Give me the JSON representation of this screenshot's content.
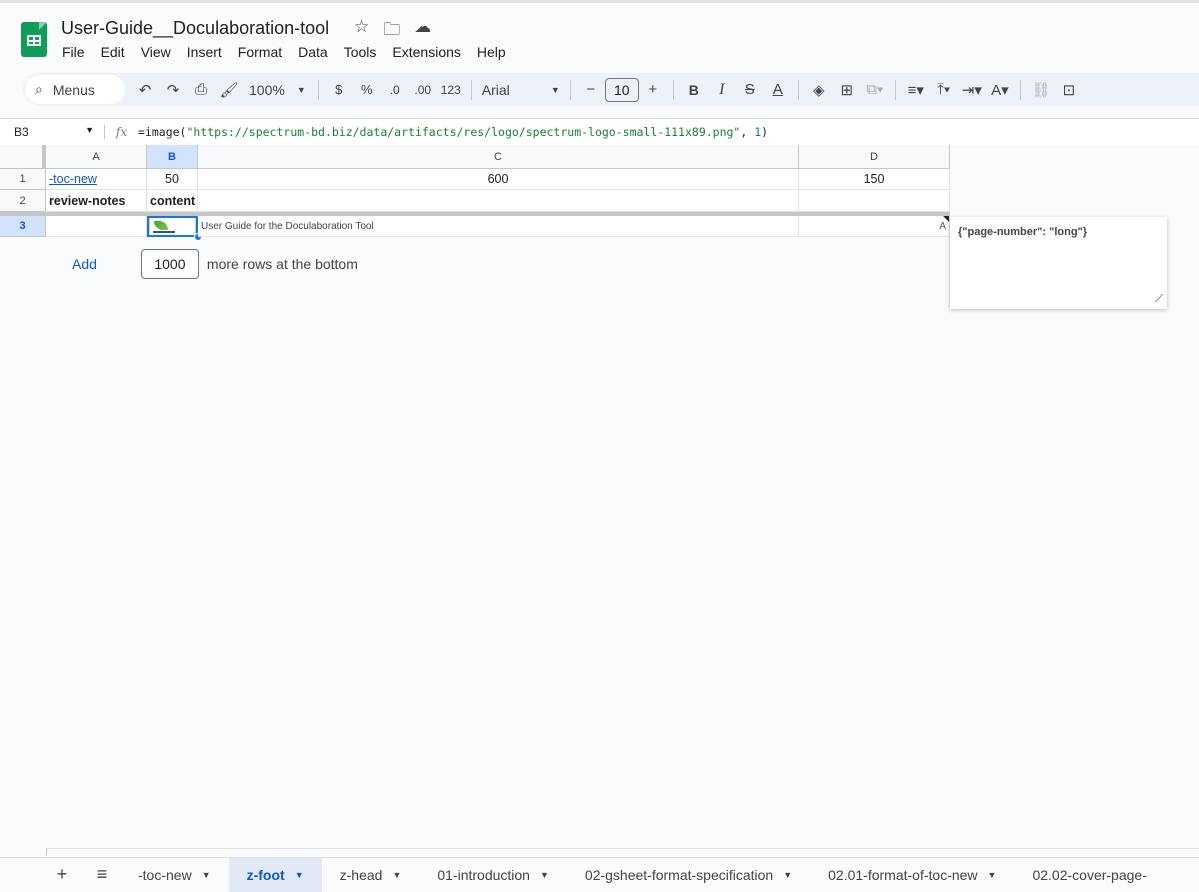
{
  "app": {
    "title": "User-Guide__Doculaboration-tool",
    "menu": [
      "File",
      "Edit",
      "View",
      "Insert",
      "Format",
      "Data",
      "Tools",
      "Extensions",
      "Help"
    ]
  },
  "toolbar": {
    "menus_label": "Menus",
    "zoom": "100%",
    "currency": "$",
    "percent": "%",
    "dec_decrease": ".0",
    "dec_increase": ".00",
    "number_format": "123",
    "font": "Arial",
    "font_size": "10",
    "minus": "−",
    "plus": "+",
    "bold": "B",
    "italic": "I"
  },
  "formula_bar": {
    "cell_ref": "B3",
    "fx": "fx",
    "formula_prefix": "=image(",
    "formula_string": "\"https://spectrum-bd.biz/data/artifacts/res/logo/spectrum-logo-small-111x89.png\"",
    "formula_sep": ", ",
    "formula_num": "1",
    "formula_suffix": ")"
  },
  "grid": {
    "columns": [
      "A",
      "B",
      "C",
      "D"
    ],
    "rows": [
      "1",
      "2",
      "3"
    ],
    "r1": {
      "a": "-toc-new",
      "b": "50",
      "c": "600",
      "d": "150"
    },
    "r2": {
      "a": "review-notes",
      "b": "content"
    },
    "r3": {
      "c": "User Guide for the Doculaboration Tool",
      "d": "A"
    }
  },
  "note": {
    "text": "{\"page-number\":  \"long\"}"
  },
  "add_rows": {
    "button": "Add",
    "count": "1000",
    "suffix": "more rows at the bottom"
  },
  "tabs": [
    {
      "label": "-toc-new"
    },
    {
      "label": "z-foot"
    },
    {
      "label": "z-head"
    },
    {
      "label": "01-introduction"
    },
    {
      "label": "02-gsheet-format-specification"
    },
    {
      "label": "02.01-format-of-toc-new"
    },
    {
      "label": "02.02-cover-page-"
    }
  ],
  "colors": {
    "accent": "#0b57d0",
    "sheets_green": "#0f9d58",
    "formula_string": "#188038"
  }
}
